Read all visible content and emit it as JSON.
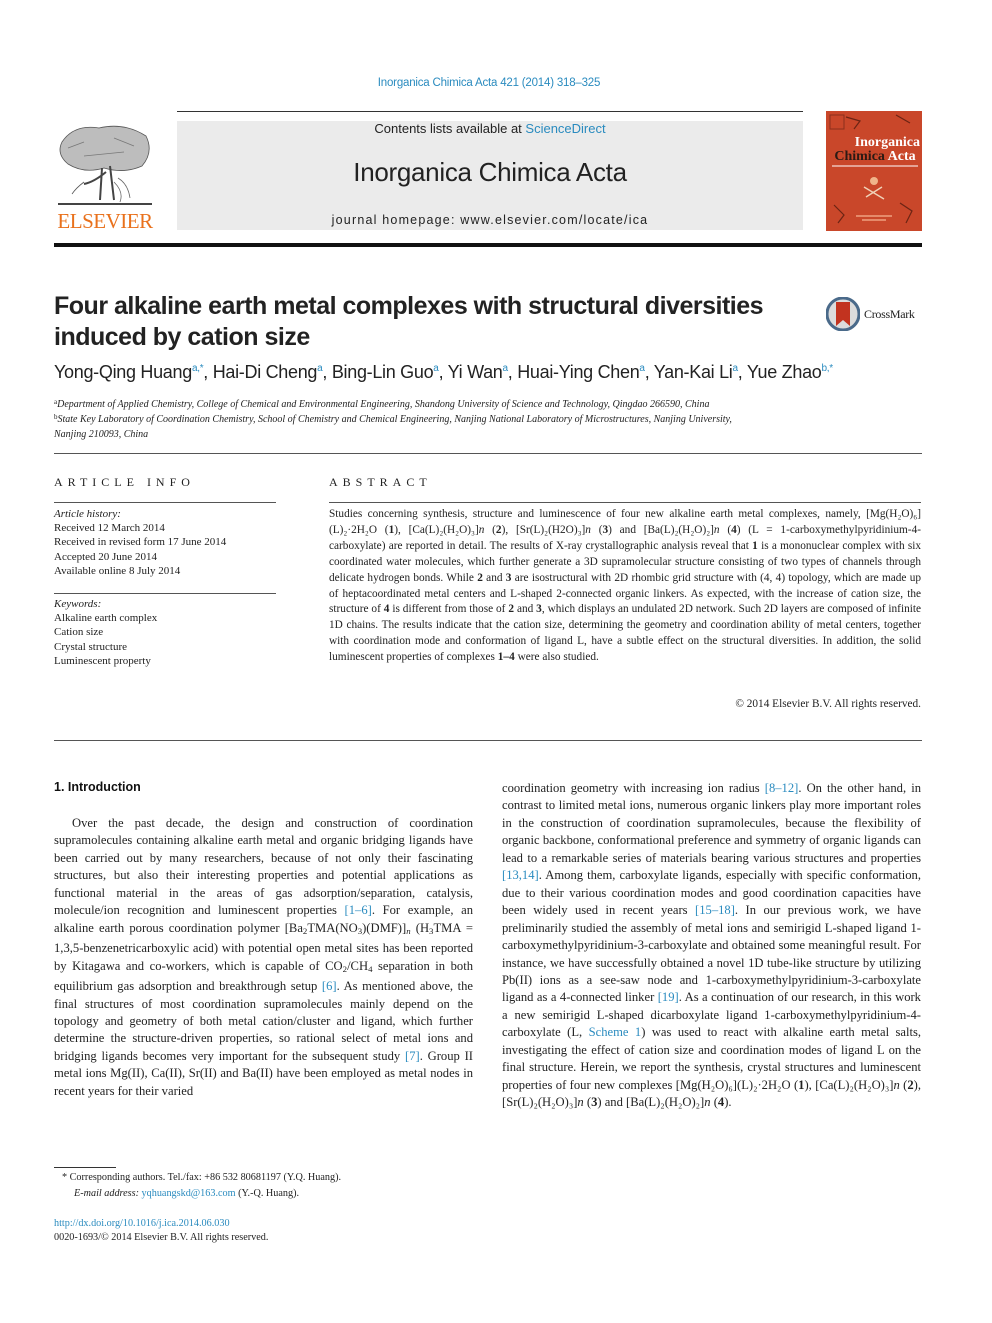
{
  "journal_ref": "Inorganica Chimica Acta 421 (2014) 318–325",
  "masthead": {
    "contents_prefix": "Contents lists available at ",
    "contents_link": "ScienceDirect",
    "journal_title": "Inorganica Chimica Acta",
    "homepage": "journal homepage: www.elsevier.com/locate/ica"
  },
  "publisher": {
    "name": "ELSEVIER",
    "color": "#e9711c"
  },
  "cover": {
    "line1": "Inorganica",
    "line2a": "Chimica ",
    "line2b": "Acta",
    "color": "#c9472a"
  },
  "crossmark": {
    "label": "CrossMark"
  },
  "article": {
    "title": "Four alkaline earth metal complexes with structural diversities induced by cation size",
    "authors": [
      {
        "name": "Yong-Qing Huang",
        "sup": "a,*",
        "sep": ", "
      },
      {
        "name": "Hai-Di Cheng",
        "sup": "a",
        "sep": ", "
      },
      {
        "name": "Bing-Lin Guo",
        "sup": "a",
        "sep": ", "
      },
      {
        "name": "Yi Wan",
        "sup": "a",
        "sep": ", "
      },
      {
        "name": "Huai-Ying Chen",
        "sup": "a",
        "sep": ", "
      },
      {
        "name": "Yan-Kai Li",
        "sup": "a",
        "sep": ", "
      },
      {
        "name": "Yue Zhao",
        "sup": "b,*",
        "sep": ""
      }
    ],
    "affiliations": [
      {
        "mark": "a",
        "text": "Department of Applied Chemistry, College of Chemical and Environmental Engineering, Shandong University of Science and Technology, Qingdao 266590, China"
      },
      {
        "mark": "b",
        "text": "State Key Laboratory of Coordination Chemistry, School of Chemistry and Chemical Engineering, Nanjing National Laboratory of Microstructures, Nanjing University,",
        "text2": "Nanjing 210093, China"
      }
    ]
  },
  "article_info": {
    "heading": "ARTICLE INFO",
    "history_heading": "Article history:",
    "history": [
      "Received 12 March 2014",
      "Received in revised form 17 June 2014",
      "Accepted 20 June 2014",
      "Available online 8 July 2014"
    ],
    "keywords_heading": "Keywords:",
    "keywords": [
      "Alkaline earth complex",
      "Cation size",
      "Crystal structure",
      "Luminescent property"
    ]
  },
  "abstract": {
    "heading": "ABSTRACT",
    "p1": "Studies concerning synthesis, structure and luminescence of four new alkaline earth metal complexes, namely,",
    "c1": "[Mg(H₂O)₆](L)₂·2H₂O",
    "c2": "[Ca(L)₂(H₂O)₃]",
    "c3": "[Sr(L)₂(H2O)₃]",
    "c4": "[Ba(L)₂(H₂O)₂]",
    "n": "n",
    "and": "and",
    "p2": "(L = 1-carboxymethylpyridinium-4-carboxylate) are reported in detail. The results of X-ray crystallographic analysis reveal that",
    "p3": "is a mononuclear complex with six coordinated water molecules, which further generate a 3D supramolecular structure consisting of two types of channels through delicate hydrogen bonds. While",
    "p4": "are isostructural with 2D rhombic grid structure with (4, 4) topology, which are made up of heptacoordinated metal centers and L-shaped 2-connected organic linkers. As expected, with the increase of cation size, the structure of",
    "p5": "is different from those of",
    "p6": ", which displays an undulated 2D network. Such 2D layers are composed of infinite 1D chains. The results indicate that the cation size, determining the geometry and coordination ability of metal centers, together with coordination mode and conformation of ligand L, have a subtle effect on the structural diversities. In addition, the solid luminescent properties of complexes",
    "range": "1–4",
    "p7": "were also studied.",
    "copyright": "© 2014 Elsevier B.V. All rights reserved."
  },
  "intro": {
    "heading": "1. Introduction",
    "left": {
      "t1": "Over the past decade, the design and construction of coordination supramolecules containing alkaline earth metal and organic bridging ligands have been carried out by many researchers, because of not only their fascinating structures, but also their interesting properties and potential applications as functional material in the areas of gas adsorption/separation, catalysis, molecule/ion recognition and luminescent properties",
      "r1": "[1–6]",
      "t2": ". For example, an alkaline earth porous coordination polymer [Ba",
      "t3": "TMA(NO",
      "t4": ")(DMF)]",
      "t5": " (H",
      "t6": "TMA = 1,3,5-benzenetricarboxylic acid) with potential open metal sites has been reported by Kitagawa and co-workers, which is capable of CO",
      "t7": "/CH",
      "t8": " separation in both equilibrium gas adsorption and breakthrough setup",
      "r2": "[6]",
      "t9": ". As mentioned above, the final structures of most coordination supramolecules mainly depend on the topology and geometry of both metal cation/cluster and ligand, which further determine the structure-driven properties, so rational select of metal ions and bridging ligands becomes very important for the subsequent study",
      "r3": "[7]",
      "t10": ". Group II metal ions Mg(II), Ca(II), Sr(II) and Ba(II) have been employed as metal nodes in recent years for their varied"
    },
    "right": {
      "t1": "coordination geometry with increasing ion radius",
      "r1": "[8–12]",
      "t2": ". On the other hand, in contrast to limited metal ions, numerous organic linkers play more important roles in the construction of coordination supramolecules, because the flexibility of organic backbone, conformational preference and symmetry of organic ligands can lead to a remarkable series of materials bearing various structures and properties",
      "r2": "[13,14]",
      "t3": ". Among them, carboxylate ligands, especially with specific conformation, due to their various coordination modes and good coordination capacities have been widely used in recent years",
      "r3": "[15–18]",
      "t4": ". In our previous work, we have preliminarily studied the assembly of metal ions and semirigid L-shaped ligand 1-carboxymethylpyridinium-3-carboxylate and obtained some meaningful result. For instance, we have successfully obtained a novel 1D tube-like structure by utilizing Pb(II) ions as a see-saw node and 1-carboxymethylpyridinium-3-carboxylate ligand as a 4-connected linker",
      "r4": "[19]",
      "t5": ". As a continuation of our research, in this work a new semirigid L-shaped dicarboxylate ligand 1-carboxymethylpyridinium-4-carboxylate (L,",
      "r5": "Scheme 1",
      "t6": ") was used to react with alkaline earth metal salts, investigating the effect of cation size and coordination modes of ligand L on the final structure. Herein, we report the synthesis, crystal structures and luminescent properties of four new complexes [Mg(H₂O)₆](L)₂·2H₂O (",
      "t7": "), [Ca(L)₂(H₂O)₃]",
      "t8": " (",
      "t9": "), [Sr(L)₂(H₂O)₃]",
      "t10": " (",
      "t11": ") and [Ba(L)₂(H₂O)₂]",
      "t12": " (",
      "t13": ")."
    }
  },
  "footnotes": {
    "corresponding": "* Corresponding authors. Tel./fax: +86 532 80681197 (Y.Q. Huang).",
    "email_label": "E-mail address:",
    "email": "yqhuangskd@163.com",
    "email_suffix": " (Y.-Q. Huang).",
    "doi": "http://dx.doi.org/10.1016/j.ica.2014.06.030",
    "issn": "0020-1693/© 2014 Elsevier B.V. All rights reserved."
  }
}
